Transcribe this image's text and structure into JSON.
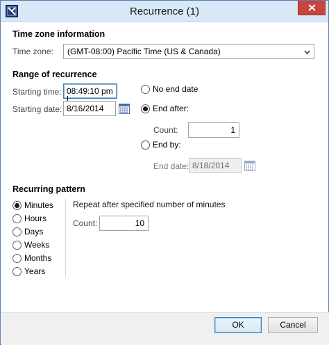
{
  "window": {
    "title": "Recurrence (1)"
  },
  "timezone": {
    "section_title": "Time zone information",
    "label": "Time zone:",
    "value": "(GMT-08:00) Pacific Time (US & Canada)"
  },
  "range": {
    "section_title": "Range of recurrence",
    "starting_time_label": "Starting time:",
    "starting_time_value": "08:49:10 pm",
    "starting_date_label": "Starting date:",
    "starting_date_value": "8/16/2014",
    "no_end_date_label": "No end date",
    "end_after_label": "End after:",
    "count_label": "Count:",
    "count_value": "1",
    "end_by_label": "End by:",
    "end_date_label": "End date:",
    "end_date_value": "8/18/2014",
    "selected": "end_after"
  },
  "pattern": {
    "section_title": "Recurring pattern",
    "options": [
      "Minutes",
      "Hours",
      "Days",
      "Weeks",
      "Months",
      "Years"
    ],
    "selected": "Minutes",
    "description": "Repeat after specified number of minutes",
    "count_label": "Count:",
    "count_value": "10"
  },
  "buttons": {
    "ok": "OK",
    "cancel": "Cancel"
  },
  "colors": {
    "titlebar": "#d9e8f7",
    "close": "#c7453c",
    "focus": "#3c7fb1"
  }
}
